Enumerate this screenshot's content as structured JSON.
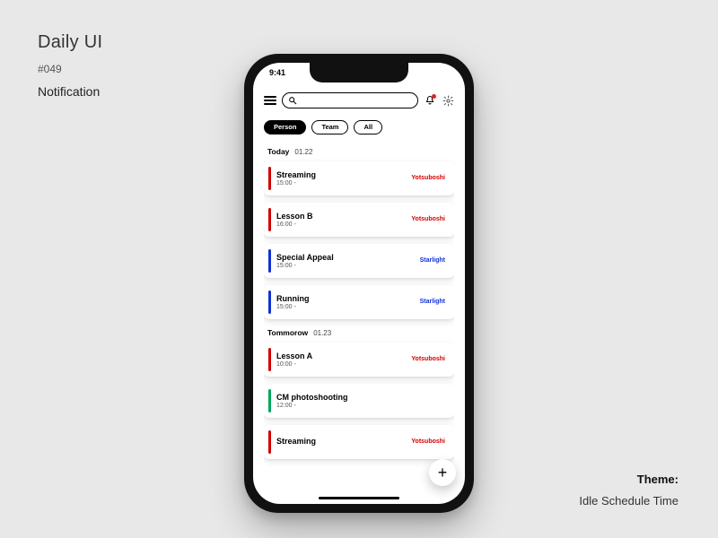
{
  "page": {
    "title": "Daily UI",
    "number": "#049",
    "subtitle": "Notification"
  },
  "theme": {
    "label": "Theme:",
    "value": "Idle Schedule Time"
  },
  "status": {
    "time": "9:41"
  },
  "search": {
    "placeholder": ""
  },
  "chips": [
    {
      "label": "Person",
      "active": true
    },
    {
      "label": "Team",
      "active": false
    },
    {
      "label": "All",
      "active": false
    }
  ],
  "colors": {
    "red": "#d40000",
    "blue": "#1030d6",
    "green": "#00a85a"
  },
  "sections": [
    {
      "day": "Today",
      "date": "01.22",
      "items": [
        {
          "title": "Streaming",
          "time": "15:00 -",
          "tag": "Yotsuboshi",
          "stripe": "red",
          "tagColor": "red"
        },
        {
          "title": "Lesson B",
          "time": "16:00 -",
          "tag": "Yotsuboshi",
          "stripe": "red",
          "tagColor": "red"
        },
        {
          "title": "Special Appeal",
          "time": "15:00 -",
          "tag": "Starlight",
          "stripe": "blue",
          "tagColor": "blue"
        },
        {
          "title": "Running",
          "time": "15:00 -",
          "tag": "Starlight",
          "stripe": "blue",
          "tagColor": "blue"
        }
      ]
    },
    {
      "day": "Tommorow",
      "date": "01.23",
      "items": [
        {
          "title": "Lesson A",
          "time": "10:00 -",
          "tag": "Yotsuboshi",
          "stripe": "red",
          "tagColor": "red"
        },
        {
          "title": "CM photoshooting",
          "time": "12:00 -",
          "tag": "",
          "stripe": "green",
          "tagColor": "green"
        },
        {
          "title": "Streaming",
          "time": "",
          "tag": "Yotsuboshi",
          "stripe": "red",
          "tagColor": "red"
        }
      ]
    }
  ],
  "fab": {
    "label": "+"
  }
}
